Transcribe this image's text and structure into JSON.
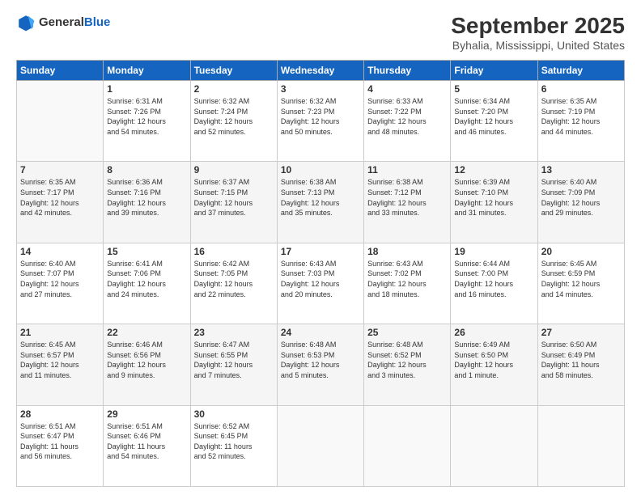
{
  "logo": {
    "general": "General",
    "blue": "Blue"
  },
  "header": {
    "month": "September 2025",
    "location": "Byhalia, Mississippi, United States"
  },
  "weekdays": [
    "Sunday",
    "Monday",
    "Tuesday",
    "Wednesday",
    "Thursday",
    "Friday",
    "Saturday"
  ],
  "weeks": [
    [
      {
        "day": "",
        "info": ""
      },
      {
        "day": "1",
        "info": "Sunrise: 6:31 AM\nSunset: 7:26 PM\nDaylight: 12 hours\nand 54 minutes."
      },
      {
        "day": "2",
        "info": "Sunrise: 6:32 AM\nSunset: 7:24 PM\nDaylight: 12 hours\nand 52 minutes."
      },
      {
        "day": "3",
        "info": "Sunrise: 6:32 AM\nSunset: 7:23 PM\nDaylight: 12 hours\nand 50 minutes."
      },
      {
        "day": "4",
        "info": "Sunrise: 6:33 AM\nSunset: 7:22 PM\nDaylight: 12 hours\nand 48 minutes."
      },
      {
        "day": "5",
        "info": "Sunrise: 6:34 AM\nSunset: 7:20 PM\nDaylight: 12 hours\nand 46 minutes."
      },
      {
        "day": "6",
        "info": "Sunrise: 6:35 AM\nSunset: 7:19 PM\nDaylight: 12 hours\nand 44 minutes."
      }
    ],
    [
      {
        "day": "7",
        "info": "Sunrise: 6:35 AM\nSunset: 7:17 PM\nDaylight: 12 hours\nand 42 minutes."
      },
      {
        "day": "8",
        "info": "Sunrise: 6:36 AM\nSunset: 7:16 PM\nDaylight: 12 hours\nand 39 minutes."
      },
      {
        "day": "9",
        "info": "Sunrise: 6:37 AM\nSunset: 7:15 PM\nDaylight: 12 hours\nand 37 minutes."
      },
      {
        "day": "10",
        "info": "Sunrise: 6:38 AM\nSunset: 7:13 PM\nDaylight: 12 hours\nand 35 minutes."
      },
      {
        "day": "11",
        "info": "Sunrise: 6:38 AM\nSunset: 7:12 PM\nDaylight: 12 hours\nand 33 minutes."
      },
      {
        "day": "12",
        "info": "Sunrise: 6:39 AM\nSunset: 7:10 PM\nDaylight: 12 hours\nand 31 minutes."
      },
      {
        "day": "13",
        "info": "Sunrise: 6:40 AM\nSunset: 7:09 PM\nDaylight: 12 hours\nand 29 minutes."
      }
    ],
    [
      {
        "day": "14",
        "info": "Sunrise: 6:40 AM\nSunset: 7:07 PM\nDaylight: 12 hours\nand 27 minutes."
      },
      {
        "day": "15",
        "info": "Sunrise: 6:41 AM\nSunset: 7:06 PM\nDaylight: 12 hours\nand 24 minutes."
      },
      {
        "day": "16",
        "info": "Sunrise: 6:42 AM\nSunset: 7:05 PM\nDaylight: 12 hours\nand 22 minutes."
      },
      {
        "day": "17",
        "info": "Sunrise: 6:43 AM\nSunset: 7:03 PM\nDaylight: 12 hours\nand 20 minutes."
      },
      {
        "day": "18",
        "info": "Sunrise: 6:43 AM\nSunset: 7:02 PM\nDaylight: 12 hours\nand 18 minutes."
      },
      {
        "day": "19",
        "info": "Sunrise: 6:44 AM\nSunset: 7:00 PM\nDaylight: 12 hours\nand 16 minutes."
      },
      {
        "day": "20",
        "info": "Sunrise: 6:45 AM\nSunset: 6:59 PM\nDaylight: 12 hours\nand 14 minutes."
      }
    ],
    [
      {
        "day": "21",
        "info": "Sunrise: 6:45 AM\nSunset: 6:57 PM\nDaylight: 12 hours\nand 11 minutes."
      },
      {
        "day": "22",
        "info": "Sunrise: 6:46 AM\nSunset: 6:56 PM\nDaylight: 12 hours\nand 9 minutes."
      },
      {
        "day": "23",
        "info": "Sunrise: 6:47 AM\nSunset: 6:55 PM\nDaylight: 12 hours\nand 7 minutes."
      },
      {
        "day": "24",
        "info": "Sunrise: 6:48 AM\nSunset: 6:53 PM\nDaylight: 12 hours\nand 5 minutes."
      },
      {
        "day": "25",
        "info": "Sunrise: 6:48 AM\nSunset: 6:52 PM\nDaylight: 12 hours\nand 3 minutes."
      },
      {
        "day": "26",
        "info": "Sunrise: 6:49 AM\nSunset: 6:50 PM\nDaylight: 12 hours\nand 1 minute."
      },
      {
        "day": "27",
        "info": "Sunrise: 6:50 AM\nSunset: 6:49 PM\nDaylight: 11 hours\nand 58 minutes."
      }
    ],
    [
      {
        "day": "28",
        "info": "Sunrise: 6:51 AM\nSunset: 6:47 PM\nDaylight: 11 hours\nand 56 minutes."
      },
      {
        "day": "29",
        "info": "Sunrise: 6:51 AM\nSunset: 6:46 PM\nDaylight: 11 hours\nand 54 minutes."
      },
      {
        "day": "30",
        "info": "Sunrise: 6:52 AM\nSunset: 6:45 PM\nDaylight: 11 hours\nand 52 minutes."
      },
      {
        "day": "",
        "info": ""
      },
      {
        "day": "",
        "info": ""
      },
      {
        "day": "",
        "info": ""
      },
      {
        "day": "",
        "info": ""
      }
    ]
  ]
}
